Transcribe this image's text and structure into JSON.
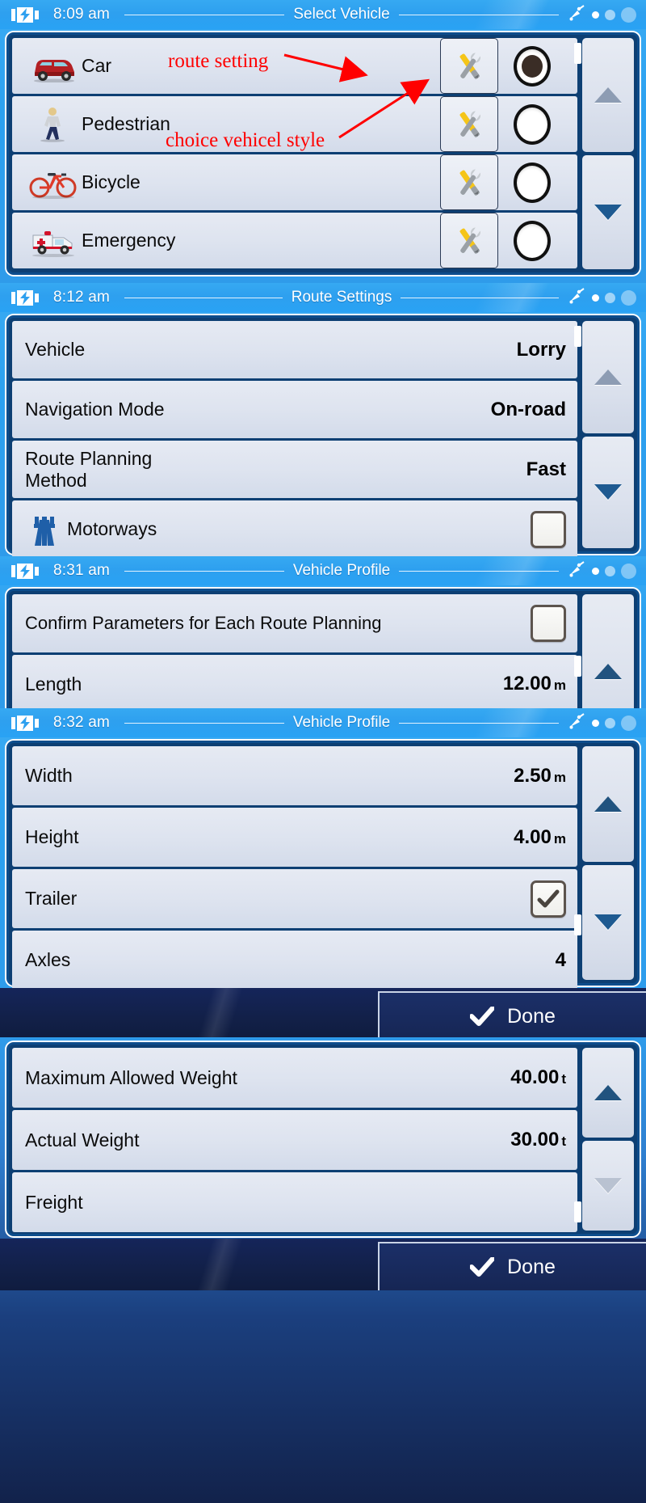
{
  "device": {
    "brand_ui": "GPS navigation settings",
    "accent_blue": "#2ea0ef",
    "panel_blue": "#0d3f73",
    "row_bg": "#e2e7f2",
    "annotation_color": "#ff0000"
  },
  "screens": [
    {
      "id": "select-vehicle",
      "time": "8:09 am",
      "title": "Select Vehicle",
      "battery_icon": "battery-charging-icon",
      "gps_icon": "satellite-dish-icon",
      "rows": [
        {
          "icon": "car-icon",
          "label": "Car",
          "tool_icon": "tools-icon",
          "selected": true
        },
        {
          "icon": "pedestrian-icon",
          "label": "Pedestrian",
          "tool_icon": "tools-icon",
          "selected": false
        },
        {
          "icon": "bicycle-icon",
          "label": "Bicycle",
          "tool_icon": "tools-icon",
          "selected": false
        },
        {
          "icon": "ambulance-icon",
          "label": "Emergency",
          "tool_icon": "tools-icon",
          "selected": false
        }
      ],
      "scroll_up_icon": "triangle-up-icon",
      "scroll_down_icon": "triangle-down-icon"
    },
    {
      "id": "route-settings",
      "time": "8:12 am",
      "title": "Route Settings",
      "rows": [
        {
          "label": "Vehicle",
          "value": "Lorry"
        },
        {
          "label": "Navigation Mode",
          "value": "On-road"
        },
        {
          "label": "Route Planning\nMethod",
          "value": "Fast"
        },
        {
          "icon": "motorway-icon",
          "label": "Motorways",
          "checkbox": false
        }
      ]
    },
    {
      "id": "vehicle-profile-1",
      "time": "8:31 am",
      "title": "Vehicle Profile",
      "rows": [
        {
          "label": "Confirm Parameters for Each Route Planning",
          "checkbox": false
        },
        {
          "label": "Length",
          "value": "12.00",
          "unit": "m"
        }
      ]
    },
    {
      "id": "vehicle-profile-2",
      "time": "8:32 am",
      "title": "Vehicle Profile",
      "rows": [
        {
          "label": "Width",
          "value": "2.50",
          "unit": "m"
        },
        {
          "label": "Height",
          "value": "4.00",
          "unit": "m"
        },
        {
          "label": "Trailer",
          "checkbox": true
        },
        {
          "label": "Axles",
          "value": "4"
        }
      ],
      "done_label": "Done",
      "done_icon": "check-icon"
    },
    {
      "id": "vehicle-profile-3",
      "rows": [
        {
          "label": "Maximum Allowed Weight",
          "value": "40.00",
          "unit": "t"
        },
        {
          "label": "Actual Weight",
          "value": "30.00",
          "unit": "t"
        },
        {
          "label": "Freight",
          "value": ""
        }
      ],
      "done_label": "Done",
      "done_icon": "check-icon"
    }
  ],
  "annotations": [
    {
      "id": "ann-route-setting",
      "text": "route setting",
      "color": "#ff0000"
    },
    {
      "id": "ann-vehicle-style",
      "text": "choice vehicel style",
      "color": "#ff0000"
    }
  ]
}
